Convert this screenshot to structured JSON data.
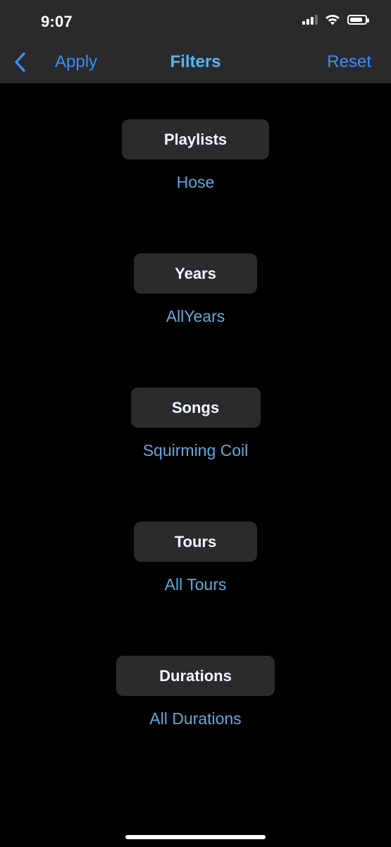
{
  "status_bar": {
    "time": "9:07",
    "signal_icon": "cellular-signal-icon",
    "wifi_icon": "wifi-icon",
    "battery_icon": "battery-icon",
    "battery_level": 0.85
  },
  "nav": {
    "back_icon": "chevron-left-icon",
    "apply_label": "Apply",
    "title": "Filters",
    "reset_label": "Reset"
  },
  "filters": [
    {
      "label": "Playlists",
      "value": "Hose"
    },
    {
      "label": "Years",
      "value": "AllYears"
    },
    {
      "label": "Songs",
      "value": "Squirming Coil"
    },
    {
      "label": "Tours",
      "value": "All Tours"
    },
    {
      "label": "Durations",
      "value": "All Durations"
    }
  ],
  "colors": {
    "background": "#000000",
    "bar_background": "#2a2a2c",
    "pill_background": "#2b2b2d",
    "accent_blue": "#3e8ef7",
    "title_blue": "#5ab4f5",
    "value_blue": "#63a9e0",
    "pill_text": "#f0faff"
  }
}
